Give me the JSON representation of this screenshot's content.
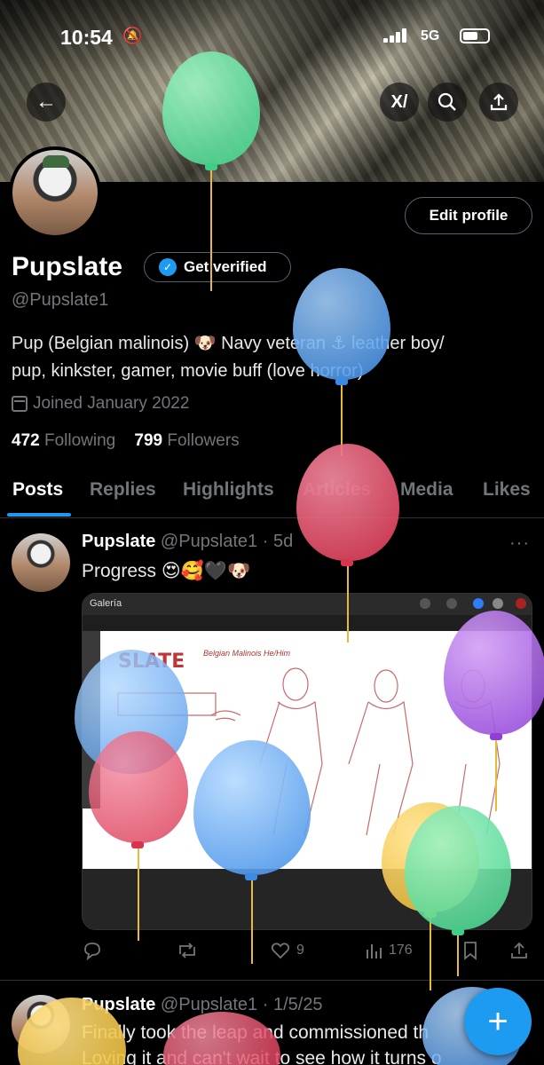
{
  "status_bar": {
    "time": "10:54",
    "network": "5G"
  },
  "header": {
    "grok_label": "X/"
  },
  "profile": {
    "edit_label": "Edit profile",
    "name": "Pupslate",
    "verify_label": "Get verified",
    "handle": "@Pupslate1",
    "bio_line1": "Pup (Belgian malinois) 🐶 Navy veteran ⚓ leather boy/",
    "bio_line2": "pup, kinkster, gamer, movie buff (love horror)",
    "joined": "Joined January 2022",
    "following_count": "472",
    "following_label": "Following",
    "followers_count": "799",
    "followers_label": "Followers"
  },
  "tabs": [
    "Posts",
    "Replies",
    "Highlights",
    "Articles",
    "Media",
    "Likes"
  ],
  "posts": [
    {
      "name": "Pupslate",
      "meta": "@Pupslate1 · 5d",
      "text": "Progress 😍🥰🖤🐶",
      "media": {
        "app_label": "Galería",
        "sketch_title": "SLATE",
        "sketch_subtitle": "Belgian Malinois He/Him"
      },
      "actions": {
        "replies": "",
        "reposts": "",
        "likes": "9",
        "views": "176"
      }
    },
    {
      "name": "Pupslate",
      "meta": "@Pupslate1 · 1/5/25",
      "text_line1": "Finally took the leap and commissioned th",
      "text_line2": "Loving it and can't wait to see how it turns o"
    }
  ],
  "fab_label": "+",
  "colors": {
    "accent": "#1d9bf0",
    "background": "#000000",
    "muted": "#71767b"
  },
  "icons": [
    "back-arrow-icon",
    "grok-icon",
    "search-icon",
    "share-icon",
    "verified-check-icon",
    "calendar-icon",
    "reply-icon",
    "repost-icon",
    "like-icon",
    "views-icon",
    "bookmark-icon",
    "share-icon",
    "compose-icon"
  ]
}
